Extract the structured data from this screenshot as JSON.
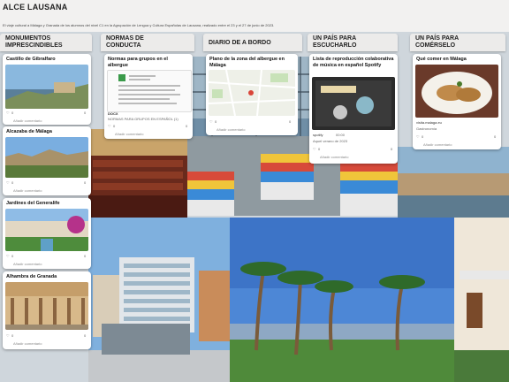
{
  "header": {
    "title": "ALCE LAUSANA",
    "subtitle": "El viaje cultural a Málaga y Granada de los alumnos del nivel C1 en la Agrupación de Lengua y Cultura Españolas de Lausana, realizado entre el 23 y el 27 de junio de 2023."
  },
  "columns": [
    {
      "label": "MONUMENTOS IMPRESCINDIBLES",
      "cards": [
        {
          "title": "Castillo de Gibralfaro",
          "likes": "0",
          "comments": "0",
          "add_comment": "Añadir comentario"
        },
        {
          "title": "Alcazaba de Málaga",
          "likes": "0",
          "comments": "0",
          "add_comment": "Añadir comentario"
        },
        {
          "title": "Jardines del Generalife",
          "likes": "0",
          "comments": "0",
          "add_comment": "Añadir comentario"
        },
        {
          "title": "Alhambra de Granada",
          "likes": "0",
          "comments": "0",
          "add_comment": "Añadir comentario"
        }
      ]
    },
    {
      "label": "NORMAS DE CONDUCTA",
      "cards": [
        {
          "title": "Normas para grupos en el albergue",
          "doc_label": "DOCX",
          "doc_name": "NORMAS PARA GRUPOS EN ESPAÑOL (1)",
          "likes": "0",
          "comments": "0",
          "add_comment": "Añadir comentario"
        }
      ]
    },
    {
      "label": "DIARIO DE A BORDO",
      "cards": [
        {
          "title": "Plano de la zona del albergue en Málaga",
          "likes": "0",
          "comments": "0",
          "add_comment": "Añadir comentario"
        }
      ]
    },
    {
      "label": "UN PAÍS PARA ESCUCHARLO",
      "cards": [
        {
          "title": "Lista de reproducción colaborativa de música en español Spotify",
          "source": "spotify",
          "duration": "00:00",
          "subtitle": "Aquel verano de 2023",
          "likes": "0",
          "comments": "0",
          "add_comment": "Añadir comentario"
        }
      ]
    },
    {
      "label": "UN PAÍS PARA COMÉRSELO",
      "cards": [
        {
          "title": "Qué comer en Málaga",
          "source": "visita.malaga.eu",
          "subtitle": "Gastronomía",
          "likes": "0",
          "comments": "0",
          "add_comment": "Añadir comentario"
        }
      ]
    }
  ],
  "colors": {
    "header_bg": "#f2f1f0",
    "column_header_bg": "#ecebea",
    "card_bg": "#ffffff"
  }
}
